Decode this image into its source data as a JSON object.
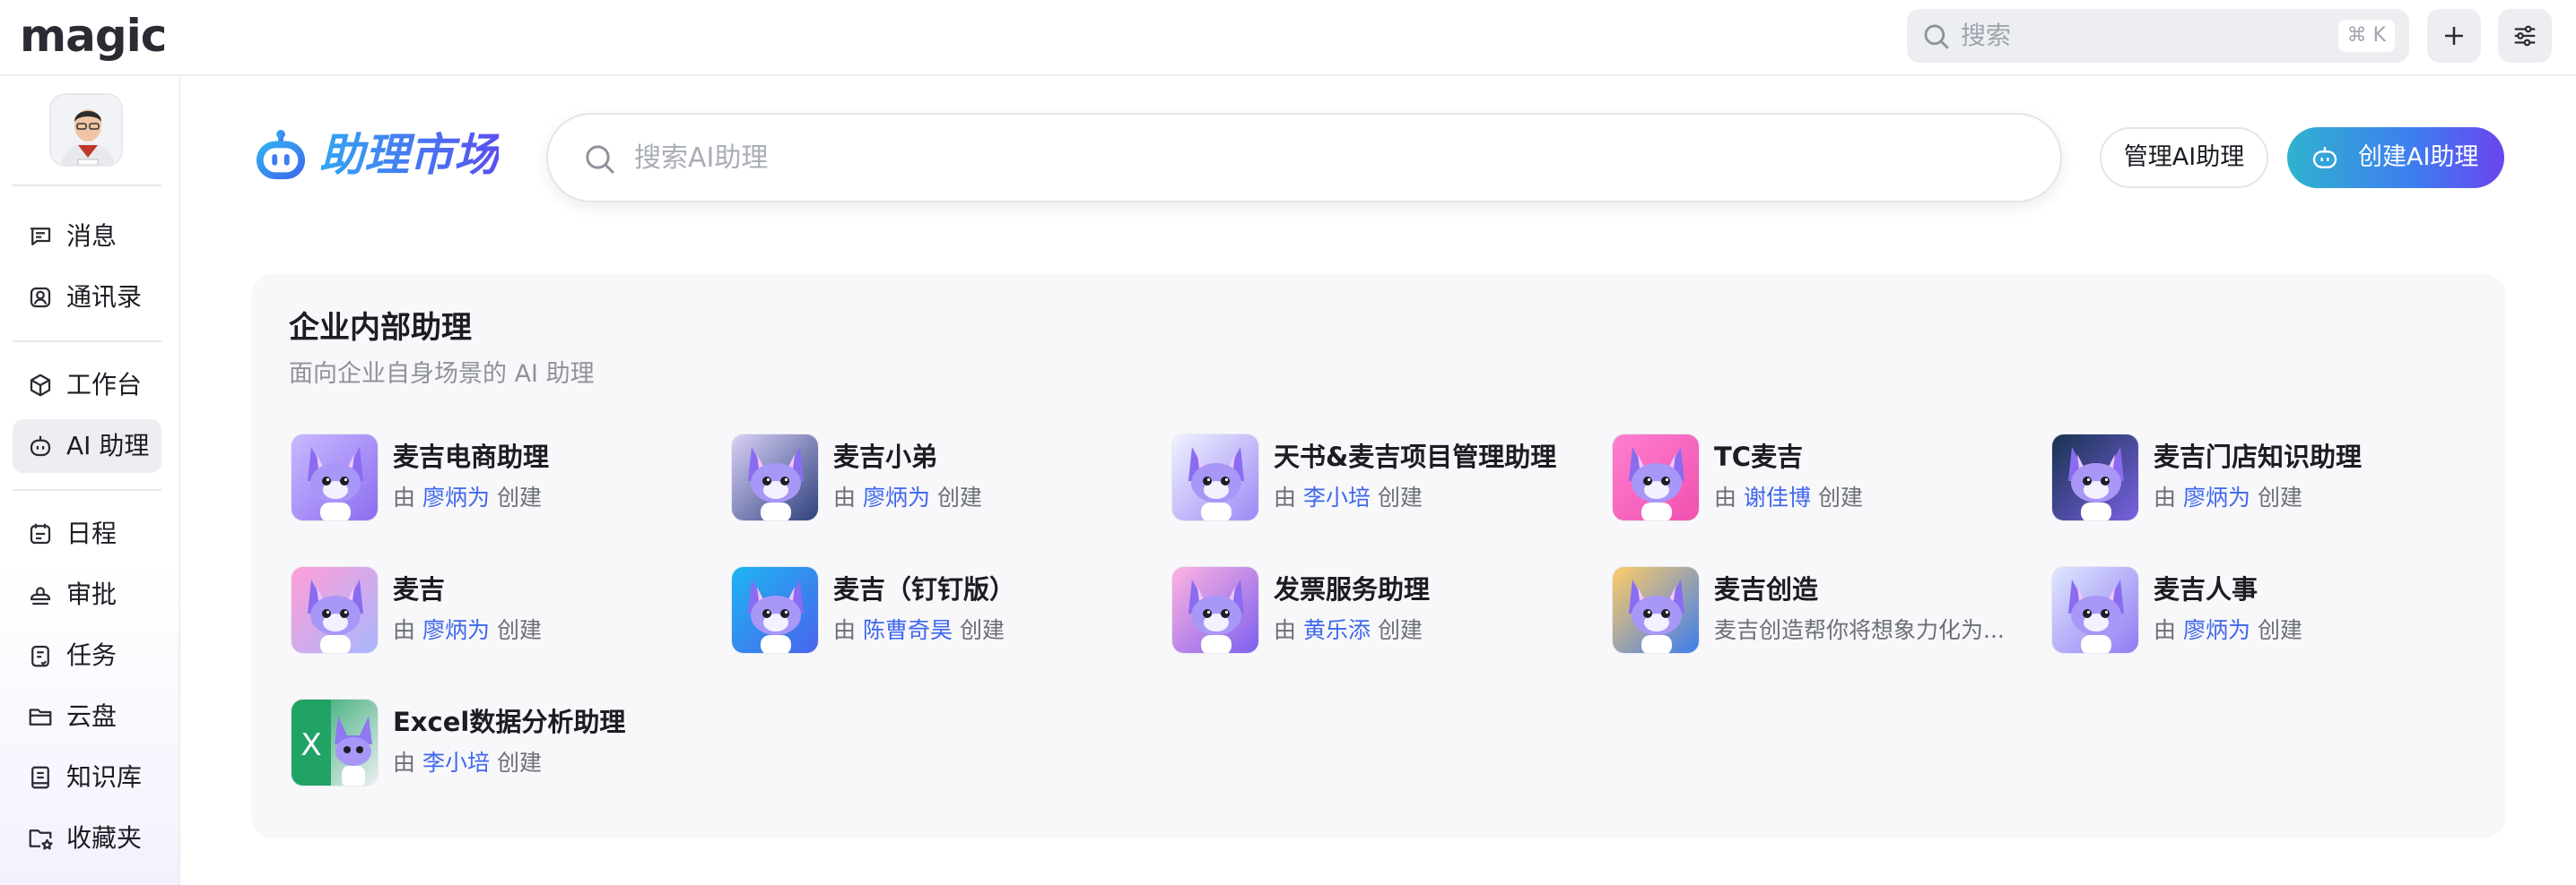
{
  "app": {
    "logo_text": "magic",
    "top_search_placeholder": "搜索",
    "top_search_shortcut": "⌘ K",
    "add_icon": "plus-icon",
    "settings_icon": "sliders-icon"
  },
  "sidebar": {
    "items": [
      {
        "label": "消息",
        "icon": "message-icon"
      },
      {
        "label": "通讯录",
        "icon": "contacts-icon"
      },
      {
        "label": "工作台",
        "icon": "cube-icon"
      },
      {
        "label": "AI 助理",
        "icon": "robot-icon",
        "active": true
      },
      {
        "label": "日程",
        "icon": "calendar-icon"
      },
      {
        "label": "审批",
        "icon": "stamp-icon"
      },
      {
        "label": "任务",
        "icon": "task-icon"
      },
      {
        "label": "云盘",
        "icon": "folder-icon"
      },
      {
        "label": "知识库",
        "icon": "book-icon"
      },
      {
        "label": "收藏夹",
        "icon": "favorite-folder-icon"
      }
    ]
  },
  "header": {
    "title": "助理市场",
    "search_placeholder": "搜索AI助理",
    "manage_label": "管理AI助理",
    "create_label": "创建AI助理"
  },
  "section": {
    "title": "企业内部助理",
    "subtitle": "面向企业自身场景的 AI 助理",
    "by_prefix": "由",
    "by_suffix": "创建",
    "assistants": [
      {
        "name": "麦吉电商助理",
        "author": "廖炳为",
        "colors": [
          "#c9b8ff",
          "#8a6cf0"
        ]
      },
      {
        "name": "麦吉小弟",
        "author": "廖炳为",
        "colors": [
          "#d9d1f7",
          "#2c3e7a"
        ]
      },
      {
        "name": "天书&麦吉项目管理助理",
        "author": "李小培",
        "colors": [
          "#eef3ff",
          "#9c86f5"
        ]
      },
      {
        "name": "TC麦吉",
        "author": "谢佳博",
        "colors": [
          "#ff7fd0",
          "#f04fae"
        ]
      },
      {
        "name": "麦吉门店知识助理",
        "author": "廖炳为",
        "colors": [
          "#18324f",
          "#7b63e6"
        ]
      },
      {
        "name": "麦吉",
        "author": "廖炳为",
        "colors": [
          "#ff9fd6",
          "#a7b6ff"
        ]
      },
      {
        "name": "麦吉（钉钉版）",
        "author": "陈曹奇昊",
        "colors": [
          "#1fb4f2",
          "#4a62ec"
        ]
      },
      {
        "name": "发票服务助理",
        "author": "黄乐添",
        "colors": [
          "#ffb3e0",
          "#7a5ef0"
        ]
      },
      {
        "name": "麦吉创造",
        "desc": "麦吉创造帮你将想象力化为...",
        "colors": [
          "#ffcc66",
          "#3a7bf0"
        ]
      },
      {
        "name": "麦吉人事",
        "author": "廖炳为",
        "colors": [
          "#dfe7ff",
          "#8e79f2"
        ]
      },
      {
        "name": "Excel数据分析助理",
        "author": "李小培",
        "colors": [
          "#21a366",
          "#f0f1f5"
        ],
        "badge": "X"
      }
    ]
  }
}
